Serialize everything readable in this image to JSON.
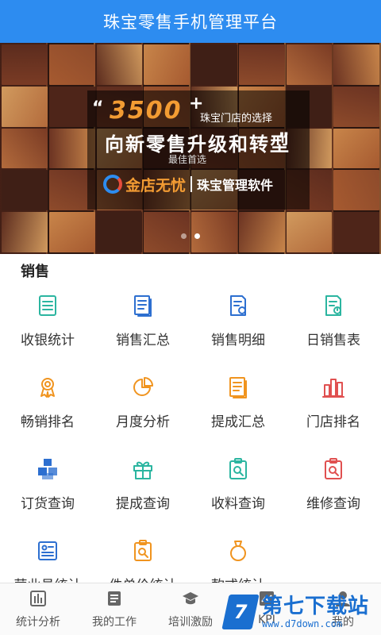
{
  "header": {
    "title": "珠宝零售手机管理平台"
  },
  "banner": {
    "number": "3500",
    "plus": "+",
    "subtitle1": "珠宝门店的选择",
    "subtitle2": "向新零售升级和转型",
    "subtitle3": "最佳首选",
    "quote_open": "“",
    "quote_close": "”",
    "brand_name": "金店无忧",
    "brand_tagline": "珠宝管理软件",
    "slide_count": 2,
    "active_slide": 2
  },
  "section": {
    "title": "销售"
  },
  "menu": [
    {
      "label": "收银统计",
      "icon": "list-icon",
      "color": "#2bb5a0"
    },
    {
      "label": "销售汇总",
      "icon": "document-icon",
      "color": "#2d6fd0"
    },
    {
      "label": "销售明细",
      "icon": "document-detail-icon",
      "color": "#2d6fd0"
    },
    {
      "label": "日销售表",
      "icon": "daily-sheet-icon",
      "color": "#2bb5a0"
    },
    {
      "label": "畅销排名",
      "icon": "medal-icon",
      "color": "#f0941f"
    },
    {
      "label": "月度分析",
      "icon": "pie-chart-icon",
      "color": "#f0941f"
    },
    {
      "label": "提成汇总",
      "icon": "document-icon",
      "color": "#f0941f"
    },
    {
      "label": "门店排名",
      "icon": "bar-ranking-icon",
      "color": "#e05050"
    },
    {
      "label": "订货查询",
      "icon": "boxes-icon",
      "color": "#2d6fd0"
    },
    {
      "label": "提成查询",
      "icon": "gift-icon",
      "color": "#2bb5a0"
    },
    {
      "label": "收料查询",
      "icon": "clipboard-search-icon",
      "color": "#2bb5a0"
    },
    {
      "label": "维修查询",
      "icon": "clipboard-search-icon",
      "color": "#e05050"
    },
    {
      "label": "营业员统计",
      "icon": "id-card-icon",
      "color": "#2d6fd0"
    },
    {
      "label": "件单价统计",
      "icon": "clipboard-search-icon",
      "color": "#f0941f"
    },
    {
      "label": "款式统计",
      "icon": "ring-icon",
      "color": "#f0941f"
    }
  ],
  "tabbar": [
    {
      "label": "统计分析",
      "icon": "chart-icon"
    },
    {
      "label": "我的工作",
      "icon": "worklist-icon"
    },
    {
      "label": "培训激励",
      "icon": "graduation-cap-icon"
    },
    {
      "label": "KPI",
      "icon": "kpi-chart-icon"
    },
    {
      "label": "我的",
      "icon": "user-icon"
    }
  ],
  "watermark": {
    "logo_char": "7",
    "big": "第七下载站",
    "small": "www.d7down.com"
  }
}
